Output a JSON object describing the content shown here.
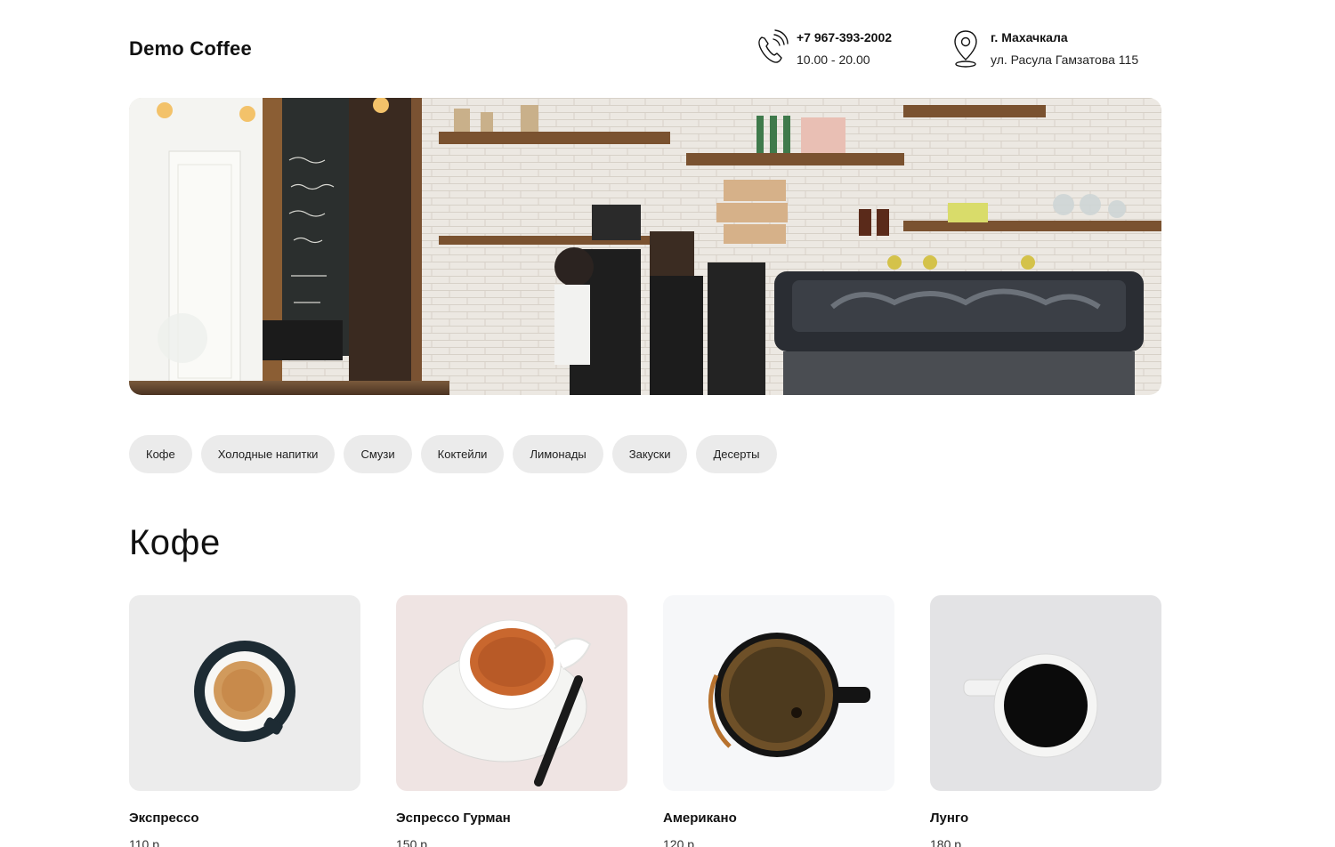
{
  "header": {
    "brand": "Demo Coffee",
    "phone": {
      "number": "+7 967-393-2002",
      "hours": "10.00 - 20.00",
      "icon": "phone-icon"
    },
    "address": {
      "city": "г. Махачкала",
      "street": "ул. Расула Гамзатова 115",
      "icon": "location-pin-icon"
    }
  },
  "categories": [
    "Кофе",
    "Холодные напитки",
    "Смузи",
    "Коктейли",
    "Лимонады",
    "Закуски",
    "Десерты"
  ],
  "section": {
    "title": "Кофе"
  },
  "products": [
    {
      "name": "Экспрессо",
      "price": "110 р."
    },
    {
      "name": "Эспрессо Гурман",
      "price": "150 р."
    },
    {
      "name": "Американо",
      "price": "120 р."
    },
    {
      "name": "Лунго",
      "price": "180 р."
    }
  ]
}
